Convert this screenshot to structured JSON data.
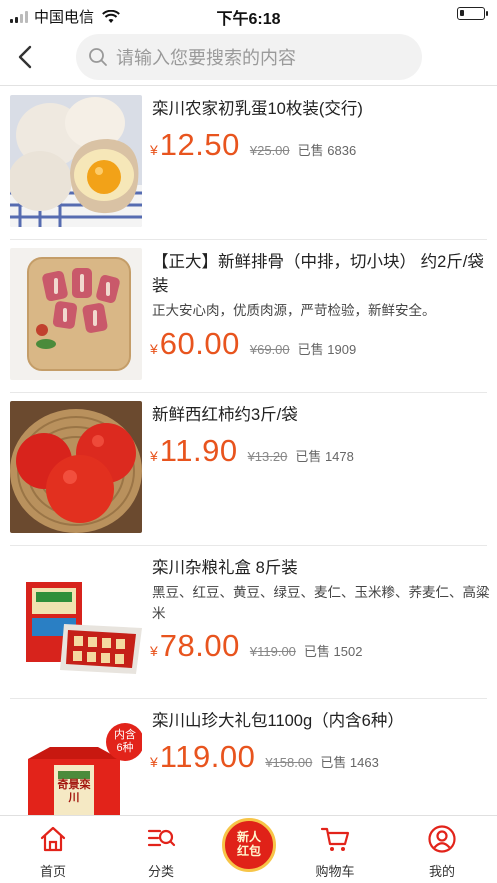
{
  "status_bar": {
    "carrier": "中国电信",
    "time": "下午6:18"
  },
  "search": {
    "placeholder": "请输入您要搜索的内容"
  },
  "products": [
    {
      "title": "栾川农家初乳蛋10枚装(交行)",
      "desc": "",
      "currency": "¥",
      "price": "12.50",
      "original_price": "¥25.00",
      "sold": "已售 6836"
    },
    {
      "title": "【正大】新鲜排骨（中排，切小块） 约2斤/袋装",
      "desc": "正大安心肉，优质肉源，严苛检验，新鲜安全。",
      "currency": "¥",
      "price": "60.00",
      "original_price": "¥69.00",
      "sold": "已售 1909"
    },
    {
      "title": "新鲜西红柿约3斤/袋",
      "desc": "",
      "currency": "¥",
      "price": "11.90",
      "original_price": "¥13.20",
      "sold": "已售 1478"
    },
    {
      "title": "栾川杂粮礼盒 8斤装",
      "desc": "黑豆、红豆、黄豆、绿豆、麦仁、玉米糁、荞麦仁、高粱米",
      "currency": "¥",
      "price": "78.00",
      "original_price": "¥119.00",
      "sold": "已售 1502"
    },
    {
      "title": "栾川山珍大礼包1100g（内含6种）",
      "desc": "",
      "currency": "¥",
      "price": "119.00",
      "original_price": "¥158.00",
      "sold": "已售 1463",
      "image_badge": "内含\n6种",
      "image_text": "奇景栾川"
    }
  ],
  "tabbar": {
    "home": "首页",
    "category": "分类",
    "promo": "新人\n红包",
    "cart": "购物车",
    "mine": "我的"
  },
  "colors": {
    "accent": "#e8541e",
    "brand_red": "#e02218"
  }
}
